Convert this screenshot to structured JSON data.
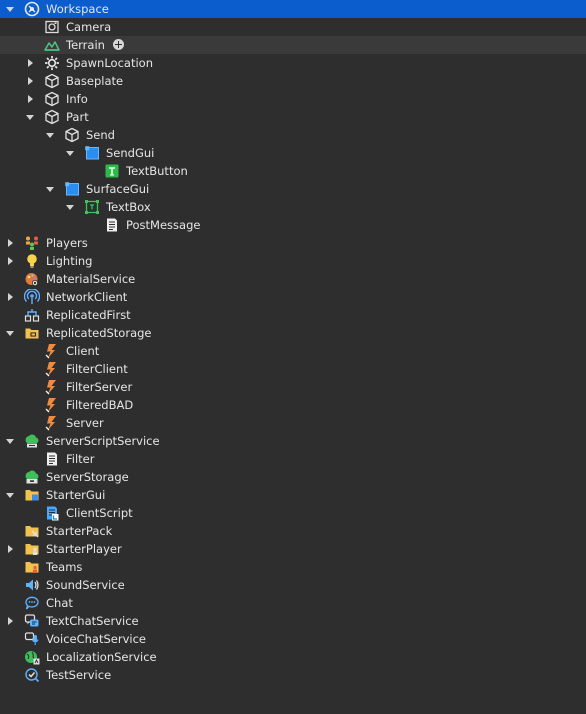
{
  "explorer": {
    "items": [
      {
        "label": "Workspace",
        "icon": "workspace-icon",
        "depth": 0,
        "arrow": "expanded",
        "state": "selected"
      },
      {
        "label": "Camera",
        "icon": "camera-icon",
        "depth": 1,
        "arrow": "none"
      },
      {
        "label": "Terrain",
        "icon": "terrain-icon",
        "depth": 1,
        "arrow": "none",
        "state": "hovered",
        "add_button": true
      },
      {
        "label": "SpawnLocation",
        "icon": "spawnlocation-icon",
        "depth": 1,
        "arrow": "collapsed"
      },
      {
        "label": "Baseplate",
        "icon": "part-icon",
        "depth": 1,
        "arrow": "collapsed"
      },
      {
        "label": "Info",
        "icon": "part-icon",
        "depth": 1,
        "arrow": "collapsed"
      },
      {
        "label": "Part",
        "icon": "part-icon",
        "depth": 1,
        "arrow": "expanded"
      },
      {
        "label": "Send",
        "icon": "part-icon",
        "depth": 2,
        "arrow": "expanded"
      },
      {
        "label": "SendGui",
        "icon": "surfacegui-icon",
        "depth": 3,
        "arrow": "expanded"
      },
      {
        "label": "TextButton",
        "icon": "textbutton-icon",
        "depth": 4,
        "arrow": "none"
      },
      {
        "label": "SurfaceGui",
        "icon": "surfacegui-icon",
        "depth": 2,
        "arrow": "expanded"
      },
      {
        "label": "TextBox",
        "icon": "textbox-icon",
        "depth": 3,
        "arrow": "expanded"
      },
      {
        "label": "PostMessage",
        "icon": "script-icon",
        "depth": 4,
        "arrow": "none"
      },
      {
        "label": "Players",
        "icon": "players-icon",
        "depth": 0,
        "arrow": "collapsed"
      },
      {
        "label": "Lighting",
        "icon": "lighting-icon",
        "depth": 0,
        "arrow": "collapsed"
      },
      {
        "label": "MaterialService",
        "icon": "materialservice-icon",
        "depth": 0,
        "arrow": "none"
      },
      {
        "label": "NetworkClient",
        "icon": "networkclient-icon",
        "depth": 0,
        "arrow": "collapsed"
      },
      {
        "label": "ReplicatedFirst",
        "icon": "replicatedfirst-icon",
        "depth": 0,
        "arrow": "none"
      },
      {
        "label": "ReplicatedStorage",
        "icon": "replicatedstorage-icon",
        "depth": 0,
        "arrow": "expanded"
      },
      {
        "label": "Client",
        "icon": "remoteevent-icon",
        "depth": 1,
        "arrow": "none"
      },
      {
        "label": "FilterClient",
        "icon": "remoteevent-icon",
        "depth": 1,
        "arrow": "none"
      },
      {
        "label": "FilterServer",
        "icon": "remoteevent-icon",
        "depth": 1,
        "arrow": "none"
      },
      {
        "label": "FilteredBAD",
        "icon": "remoteevent-icon",
        "depth": 1,
        "arrow": "none"
      },
      {
        "label": "Server",
        "icon": "remoteevent-icon",
        "depth": 1,
        "arrow": "none"
      },
      {
        "label": "ServerScriptService",
        "icon": "serverscriptservice-icon",
        "depth": 0,
        "arrow": "expanded"
      },
      {
        "label": "Filter",
        "icon": "script-icon",
        "depth": 1,
        "arrow": "none"
      },
      {
        "label": "ServerStorage",
        "icon": "serverstorage-icon",
        "depth": 0,
        "arrow": "none"
      },
      {
        "label": "StarterGui",
        "icon": "startergui-icon",
        "depth": 0,
        "arrow": "expanded"
      },
      {
        "label": "ClientScript",
        "icon": "localscript-icon",
        "depth": 1,
        "arrow": "none"
      },
      {
        "label": "StarterPack",
        "icon": "starterpack-icon",
        "depth": 0,
        "arrow": "none"
      },
      {
        "label": "StarterPlayer",
        "icon": "starterplayer-icon",
        "depth": 0,
        "arrow": "collapsed"
      },
      {
        "label": "Teams",
        "icon": "teams-icon",
        "depth": 0,
        "arrow": "none"
      },
      {
        "label": "SoundService",
        "icon": "soundservice-icon",
        "depth": 0,
        "arrow": "none"
      },
      {
        "label": "Chat",
        "icon": "chat-icon",
        "depth": 0,
        "arrow": "none"
      },
      {
        "label": "TextChatService",
        "icon": "textchatservice-icon",
        "depth": 0,
        "arrow": "collapsed"
      },
      {
        "label": "VoiceChatService",
        "icon": "voicechatservice-icon",
        "depth": 0,
        "arrow": "none"
      },
      {
        "label": "LocalizationService",
        "icon": "localizationservice-icon",
        "depth": 0,
        "arrow": "none"
      },
      {
        "label": "TestService",
        "icon": "testservice-icon",
        "depth": 0,
        "arrow": "none"
      }
    ]
  },
  "colors": {
    "background": "#2e2e2e",
    "selected": "#0b5ccc",
    "hovered": "#3a3a3a",
    "text": "#e6e6e6"
  }
}
